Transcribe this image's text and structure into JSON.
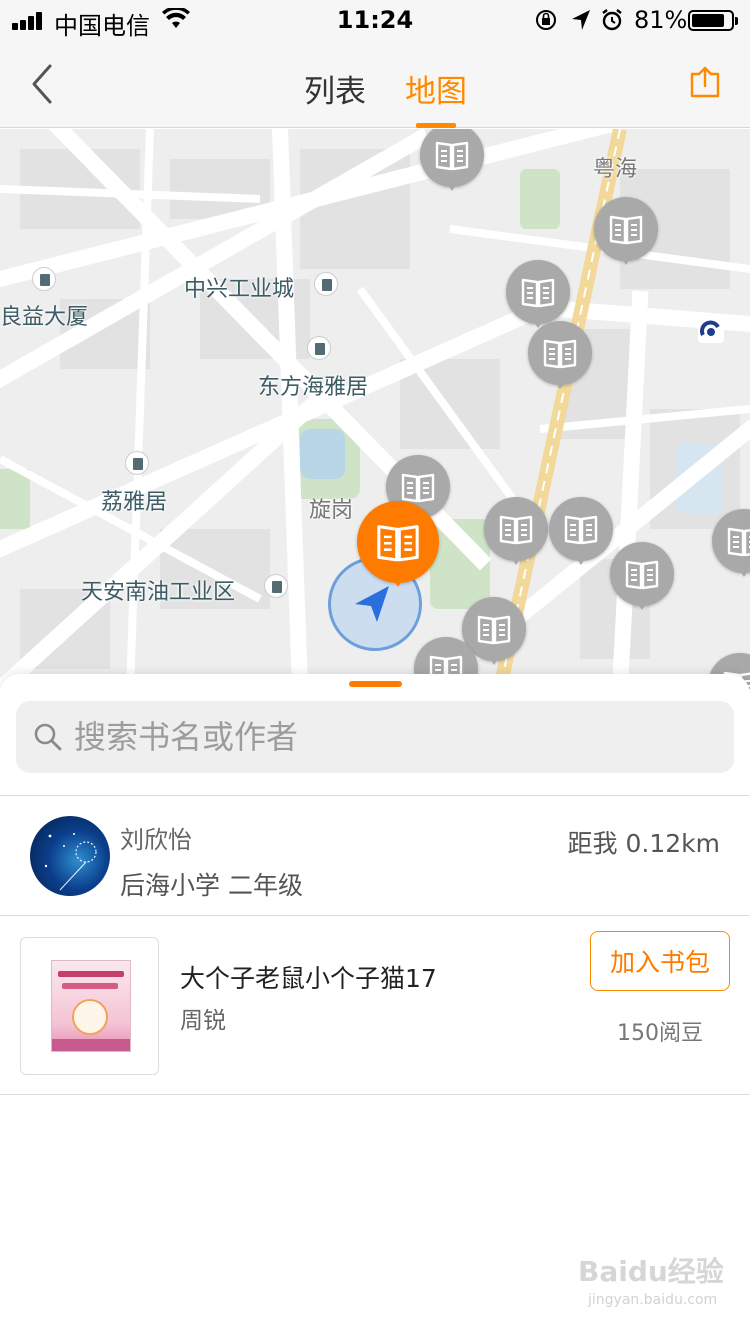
{
  "status_bar": {
    "carrier": "中国电信",
    "time": "11:24",
    "battery_percent": "81%",
    "icons": [
      "signal-icon",
      "wifi-icon",
      "rotation-lock-icon",
      "location-arrow-icon",
      "alarm-icon",
      "battery-icon"
    ]
  },
  "nav": {
    "back_icon": "chevron-left-icon",
    "tab_list": "列表",
    "tab_map": "地图",
    "active_tab": "地图",
    "share_icon": "share-icon",
    "accent_color": "#ff8a00"
  },
  "map": {
    "labels": {
      "yuehai": "粤海",
      "zhongxing": "中兴工业城",
      "liangyi": "良益大厦",
      "dongfang": "东方海雅居",
      "liya": "荔雅居",
      "xuangang": "旋岗",
      "tianan": "天安南油工业区"
    },
    "pin_icon": "book-icon",
    "selected_pin_color": "#ff7b00",
    "pin_color": "#a9a9a9",
    "location_icon": "current-location-icon"
  },
  "search": {
    "placeholder": "搜索书名或作者",
    "value": ""
  },
  "user": {
    "name": "刘欣怡",
    "school": "后海小学 二年级",
    "distance": "距我 0.12km"
  },
  "book": {
    "title": "大个子老鼠小个子猫17",
    "author": "周锐",
    "add_label": "加入书包",
    "price": "150阅豆"
  },
  "watermark": {
    "main": "Baidu经验",
    "sub": "jingyan.baidu.com"
  }
}
